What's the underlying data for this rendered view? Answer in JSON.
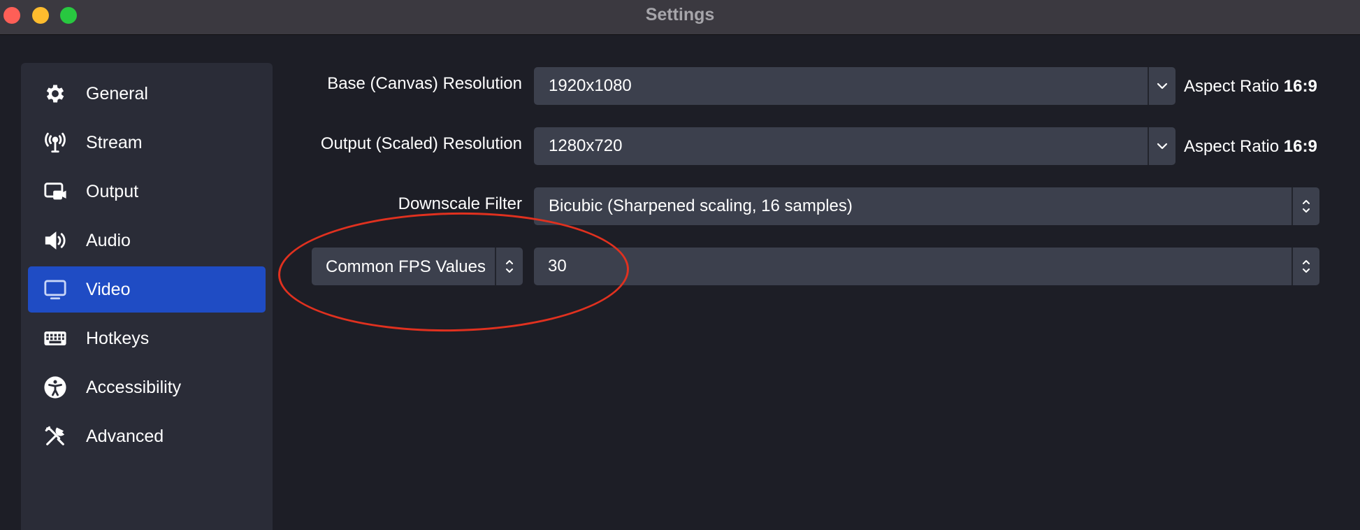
{
  "window": {
    "title": "Settings"
  },
  "sidebar": {
    "items": [
      {
        "label": "General",
        "icon": "gear-icon",
        "active": false
      },
      {
        "label": "Stream",
        "icon": "antenna-icon",
        "active": false
      },
      {
        "label": "Output",
        "icon": "output-icon",
        "active": false
      },
      {
        "label": "Audio",
        "icon": "speaker-icon",
        "active": false
      },
      {
        "label": "Video",
        "icon": "monitor-icon",
        "active": true
      },
      {
        "label": "Hotkeys",
        "icon": "keyboard-icon",
        "active": false
      },
      {
        "label": "Accessibility",
        "icon": "accessibility-icon",
        "active": false
      },
      {
        "label": "Advanced",
        "icon": "tools-icon",
        "active": false
      }
    ]
  },
  "video": {
    "base_resolution": {
      "label": "Base (Canvas) Resolution",
      "value": "1920x1080",
      "aspect_prefix": "Aspect Ratio",
      "aspect_value": "16:9"
    },
    "output_resolution": {
      "label": "Output (Scaled) Resolution",
      "value": "1280x720",
      "aspect_prefix": "Aspect Ratio",
      "aspect_value": "16:9"
    },
    "downscale_filter": {
      "label": "Downscale Filter",
      "value": "Bicubic (Sharpened scaling, 16 samples)"
    },
    "fps": {
      "type_value": "Common FPS Values",
      "value": "30"
    }
  },
  "colors": {
    "background": "#1d1e26",
    "sidebar": "#2a2c37",
    "active": "#1f4cc4",
    "field": "#3c404d",
    "annotation": "#e0311f"
  }
}
